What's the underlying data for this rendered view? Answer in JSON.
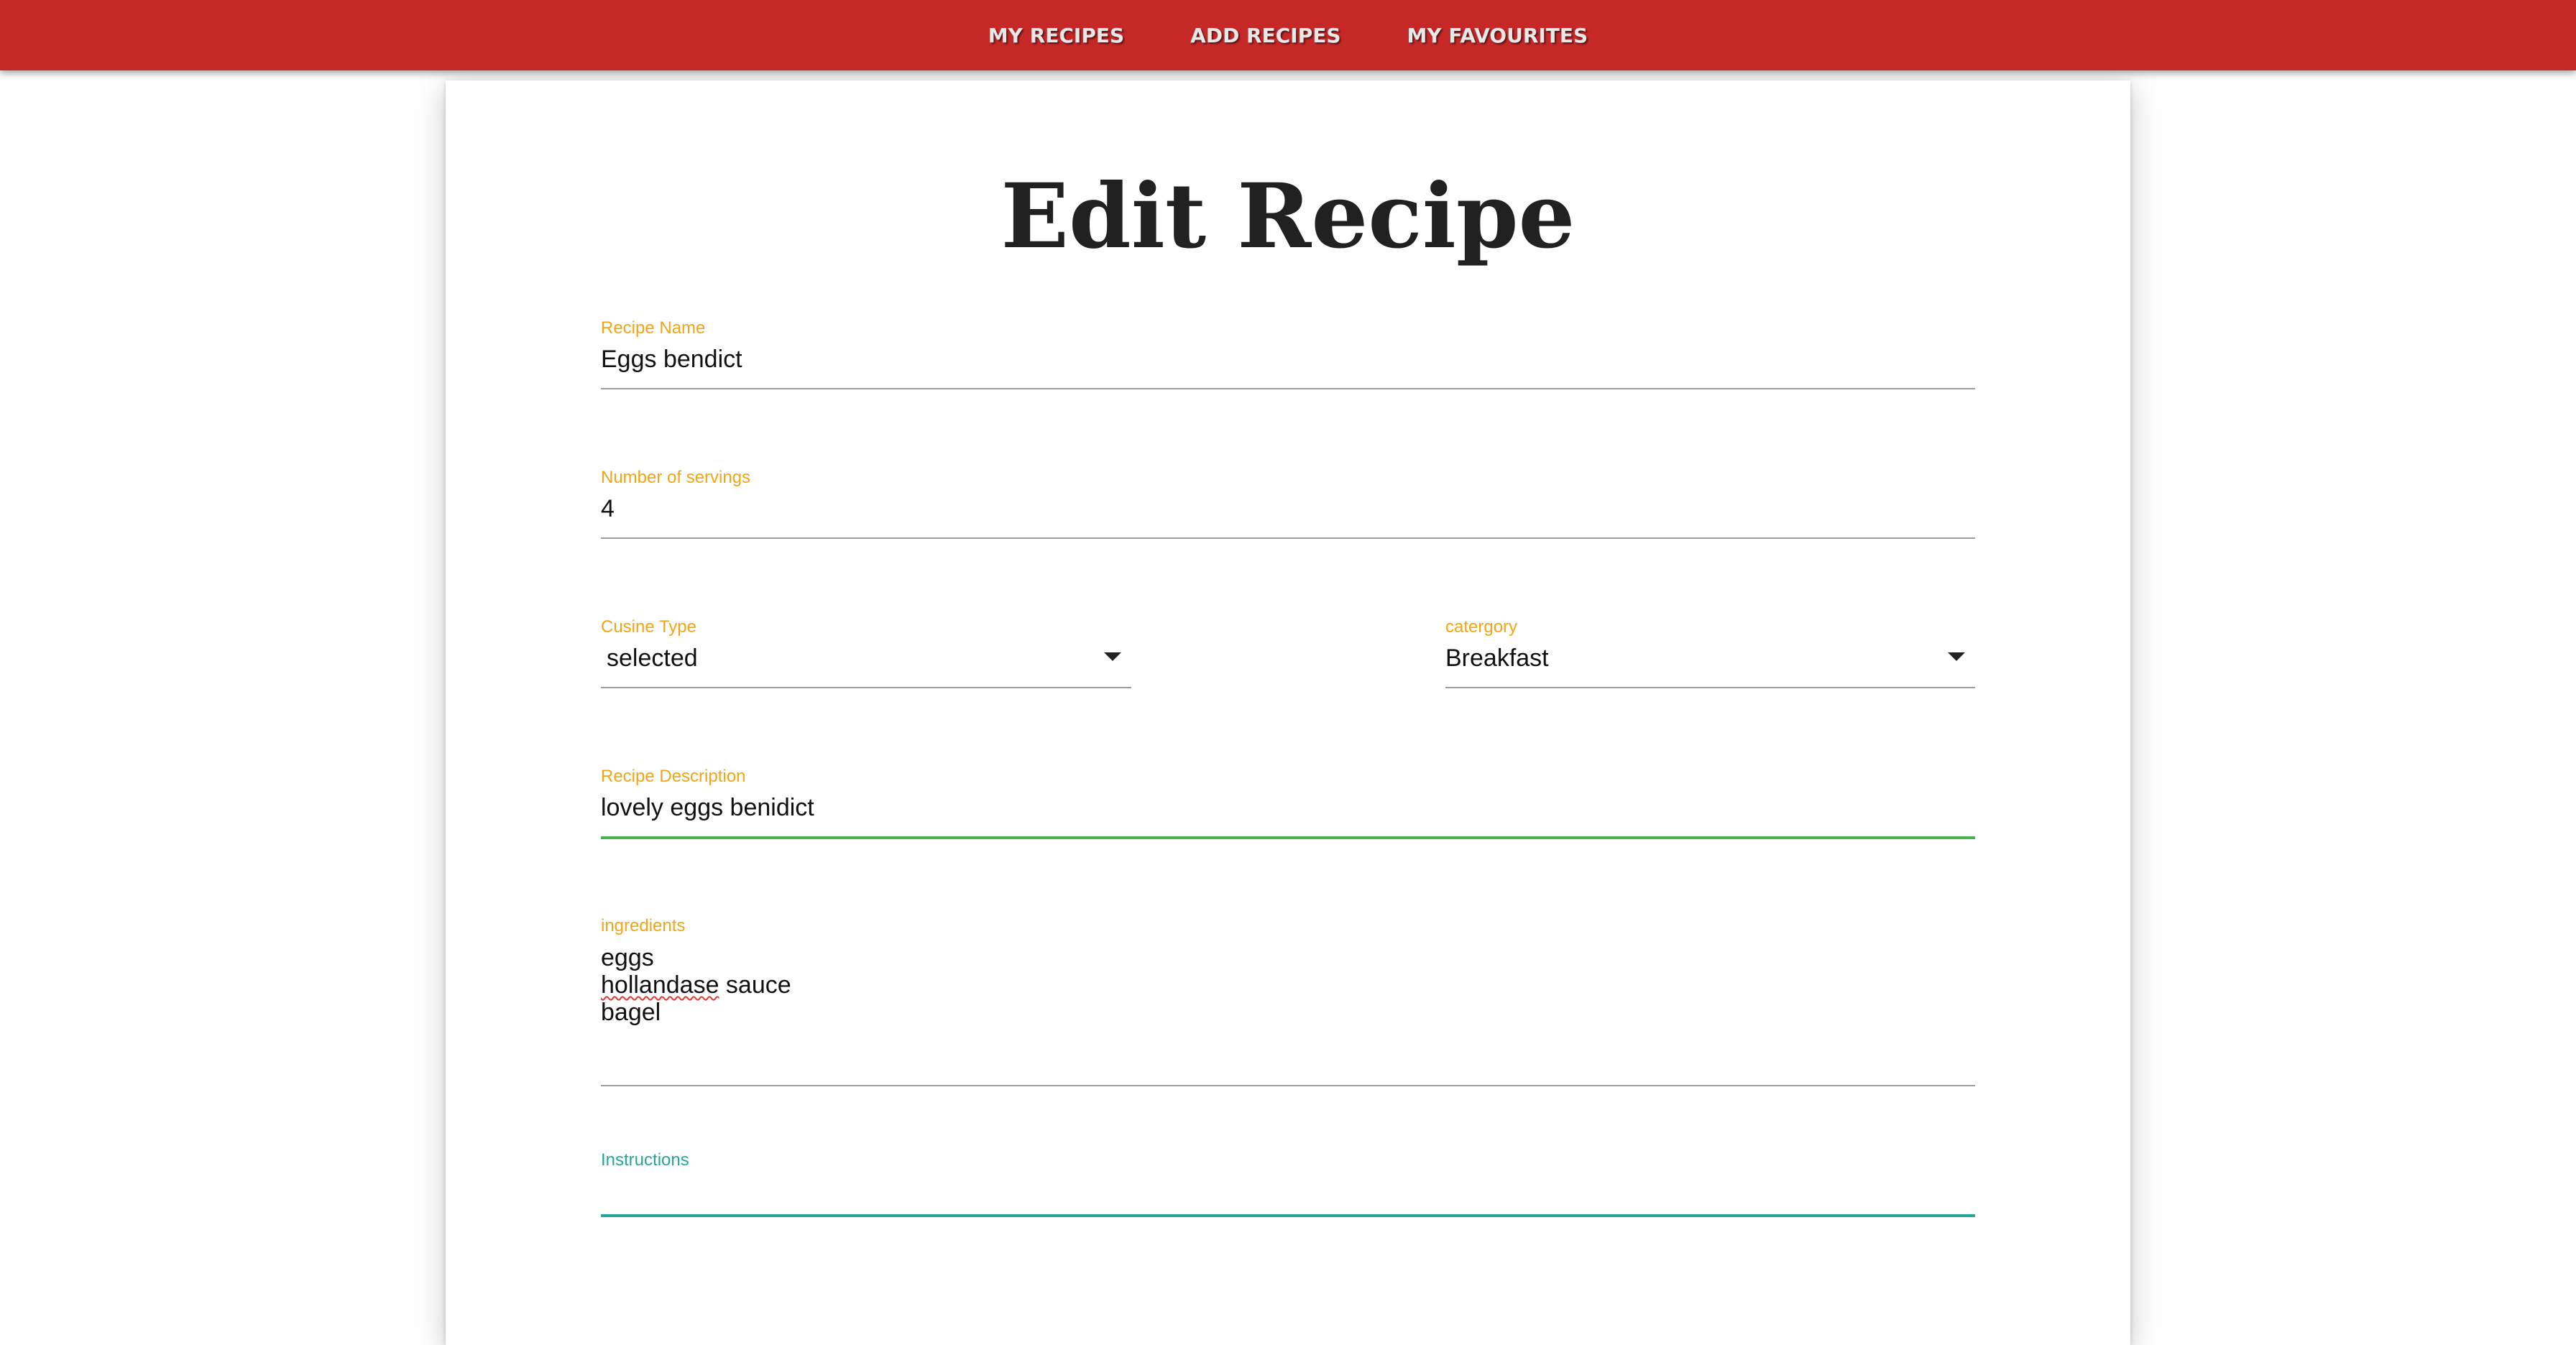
{
  "nav": {
    "items": [
      {
        "label": "MY RECIPES"
      },
      {
        "label": "ADD RECIPES"
      },
      {
        "label": "MY FAVOURITES"
      }
    ]
  },
  "page": {
    "title": "Edit Recipe"
  },
  "form": {
    "recipe_name": {
      "label": "Recipe Name",
      "value": "Eggs bendict"
    },
    "servings": {
      "label": "Number of servings",
      "value": "4"
    },
    "cuisine": {
      "label": "Cusine Type",
      "value": "selected"
    },
    "category": {
      "label": "catergory",
      "value": "Breakfast"
    },
    "description": {
      "label": "Recipe Description",
      "value": "lovely eggs benidict"
    },
    "ingredients": {
      "label": "ingredients",
      "lines": [
        "eggs",
        "hollandase",
        " sauce",
        "bagel"
      ]
    },
    "instructions": {
      "label": "Instructions",
      "value": ""
    }
  },
  "colors": {
    "navbar": "#c62828",
    "label_accent": "#f2a516",
    "active_valid": "#4caf50",
    "active_focus": "#26a69a"
  },
  "icons": {
    "select_caret": "caret-down-icon"
  }
}
